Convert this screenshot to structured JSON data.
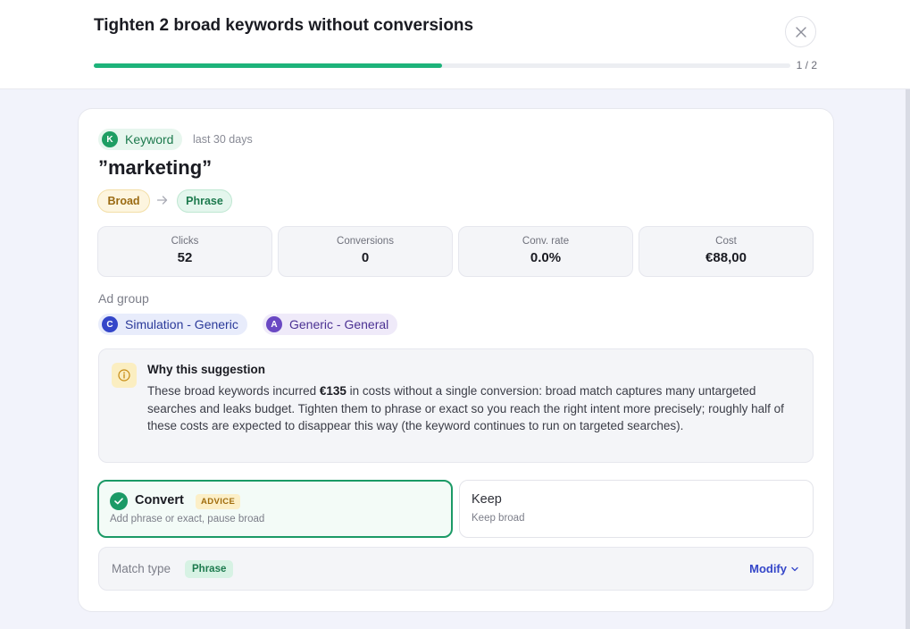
{
  "header": {
    "title": "Tighten 2 broad keywords without conversions",
    "progress_text": "1 / 2",
    "progress_fraction": 0.5
  },
  "keyword": {
    "type_badge_initial": "K",
    "type_badge_label": "Keyword",
    "period": "last 30 days",
    "title": "”marketing”",
    "match_from": "Broad",
    "match_to": "Phrase"
  },
  "stats": [
    {
      "label": "Clicks",
      "value": "52"
    },
    {
      "label": "Conversions",
      "value": "0"
    },
    {
      "label": "Conv. rate",
      "value": "0.0%"
    },
    {
      "label": "Cost",
      "value": "€88,00"
    }
  ],
  "ad_group": {
    "label": "Ad group",
    "items": [
      {
        "initial": "C",
        "name": "Simulation - Generic"
      },
      {
        "initial": "A",
        "name": "Generic - General"
      }
    ]
  },
  "why": {
    "title": "Why this suggestion",
    "text_before": "These broad keywords incurred ",
    "text_bold": "€135",
    "text_after": " in costs without a single conversion: broad match captures many untargeted searches and leaks budget. Tighten them to phrase or exact so you reach the right intent more precisely; roughly half of these costs are expected to disappear this way (the keyword continues to run on targeted searches)."
  },
  "options": {
    "convert": {
      "title": "Convert",
      "badge": "ADVICE",
      "subtitle": "Add phrase or exact, pause broad"
    },
    "keep": {
      "title": "Keep",
      "subtitle": "Keep broad"
    }
  },
  "match_type": {
    "label": "Match type",
    "value": "Phrase",
    "modify_label": "Modify"
  },
  "colors": {
    "accent_green": "#1db37a",
    "primary_blue": "#3446c9"
  }
}
